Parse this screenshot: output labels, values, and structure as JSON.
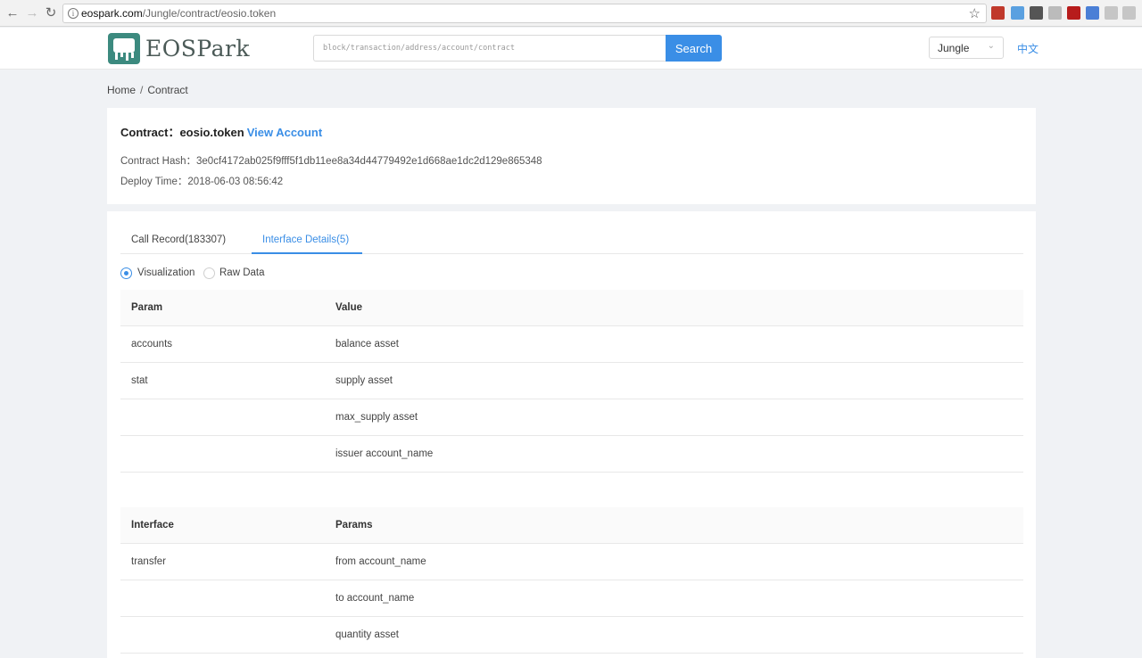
{
  "browser": {
    "url_host": "eospark.com",
    "url_path": "/Jungle/contract/eosio.token",
    "extensions": [
      {
        "name": "lastpass-icon",
        "color": "#c0392b"
      },
      {
        "name": "extension-blue-icon",
        "color": "#5aa0e0"
      },
      {
        "name": "evernote-icon",
        "color": "#555555"
      },
      {
        "name": "extension-gray-icon",
        "color": "#bbbbbb"
      },
      {
        "name": "extension-4-icon",
        "color": "#b71c1c"
      },
      {
        "name": "translate-icon",
        "color": "#4a7fd6"
      },
      {
        "name": "cloud-icon",
        "color": "#c6c6c6"
      },
      {
        "name": "extension-puzzle-icon",
        "color": "#c6c6c6"
      }
    ]
  },
  "header": {
    "logo_text": "EOSPark",
    "search_placeholder": "block/transaction/address/account/contract",
    "search_button": "Search",
    "network": "Jungle",
    "language_link": "中文"
  },
  "breadcrumb": {
    "home": "Home",
    "separator": "/",
    "current": "Contract"
  },
  "contract": {
    "title_label": "Contract：eosio.token",
    "view_account_link": "View Account",
    "hash_line": "Contract Hash：3e0cf4172ab025f9fff5f1db11ee8a34d44779492e1d668ae1dc2d129e865348",
    "deploy_line": "Deploy Time：2018-06-03 08:56:42"
  },
  "tabs": [
    {
      "label": "Call Record(183307)",
      "active": false
    },
    {
      "label": "Interface Details(5)",
      "active": true
    }
  ],
  "view_options": [
    {
      "label": "Visualization",
      "checked": true
    },
    {
      "label": "Raw Data",
      "checked": false
    }
  ],
  "tables_table": {
    "headers": [
      "Param",
      "Value"
    ],
    "rows": [
      [
        "accounts",
        "balance asset"
      ],
      [
        "stat",
        "supply asset"
      ],
      [
        "",
        "max_supply asset"
      ],
      [
        "",
        "issuer account_name"
      ]
    ]
  },
  "interfaces_table": {
    "headers": [
      "Interface",
      "Params"
    ],
    "rows": [
      [
        "transfer",
        "from account_name"
      ],
      [
        "",
        "to account_name"
      ],
      [
        "",
        "quantity asset"
      ]
    ]
  },
  "colors": {
    "accent": "#3a8ee6",
    "logo": "#3c8a7f",
    "page_background": "#f0f2f5"
  }
}
